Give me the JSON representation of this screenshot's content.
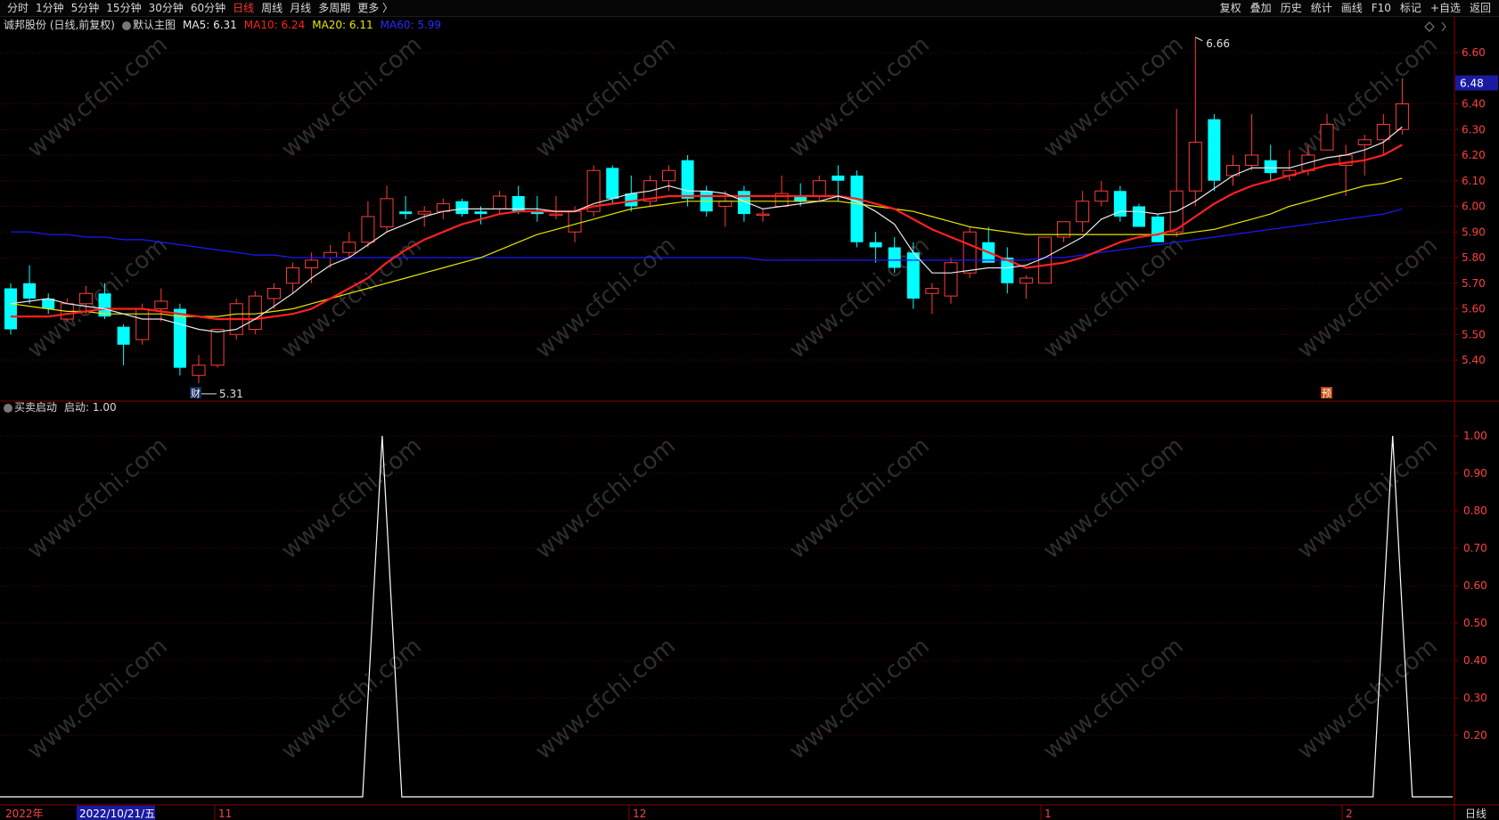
{
  "toolbar": {
    "periods": [
      "分时",
      "1分钟",
      "5分钟",
      "15分钟",
      "30分钟",
      "60分钟",
      "日线",
      "周线",
      "月线",
      "多周期",
      "更多 〉"
    ],
    "active_period": "日线",
    "right_items": [
      "复权",
      "叠加",
      "历史",
      "统计",
      "画线",
      "F10",
      "标记",
      "+自选",
      "返回"
    ]
  },
  "main_header": {
    "stock": "诚邦股份 (日线,前复权)",
    "template": "默认主图",
    "ma5": "MA5: 6.31",
    "ma10": "MA10: 6.24",
    "ma20": "MA20: 6.11",
    "ma60": "MA60: 5.99"
  },
  "colors": {
    "up": "#ff3b3b",
    "down": "#00ffff",
    "ma5": "#e8e8e8",
    "ma10": "#ff2020",
    "ma20": "#e6e600",
    "ma60": "#1a1aff",
    "grid": "#5a0000",
    "axis_text": "#ff4040",
    "indicator": "#ffffff"
  },
  "price_axis": {
    "labels": [
      "6.60",
      "6.40",
      "6.30",
      "6.20",
      "6.10",
      "6.00",
      "5.90",
      "5.80",
      "5.70",
      "5.60",
      "5.50",
      "5.40"
    ],
    "current_price": "6.48"
  },
  "annotations": {
    "high_label": "6.66",
    "low_label": "5.31",
    "finance_marker": "财",
    "forecast_marker": "预"
  },
  "indicator_header": {
    "name": "买卖启动",
    "value": "启动: 1.00"
  },
  "indicator_axis": {
    "labels": [
      "1.00",
      "0.90",
      "0.80",
      "0.70",
      "0.60",
      "0.50",
      "0.40",
      "0.30",
      "0.20"
    ]
  },
  "date_axis": {
    "year": "2022年",
    "cursor_date": "2022/10/21/五",
    "months": [
      "11",
      "12",
      "1",
      "2"
    ],
    "period_label": "日线"
  },
  "watermark": "www.cfchi.com",
  "chart_data": [
    {
      "type": "candlestick",
      "title": "诚邦股份 (日线,前复权)",
      "ylim": [
        5.31,
        6.72
      ],
      "candles": [
        {
          "o": 5.68,
          "h": 5.7,
          "l": 5.5,
          "c": 5.52
        },
        {
          "o": 5.7,
          "h": 5.77,
          "l": 5.62,
          "c": 5.64
        },
        {
          "o": 5.64,
          "h": 5.66,
          "l": 5.58,
          "c": 5.6
        },
        {
          "o": 5.56,
          "h": 5.64,
          "l": 5.55,
          "c": 5.62
        },
        {
          "o": 5.62,
          "h": 5.69,
          "l": 5.58,
          "c": 5.66
        },
        {
          "o": 5.66,
          "h": 5.7,
          "l": 5.56,
          "c": 5.57
        },
        {
          "o": 5.53,
          "h": 5.54,
          "l": 5.38,
          "c": 5.46
        },
        {
          "o": 5.48,
          "h": 5.62,
          "l": 5.46,
          "c": 5.6
        },
        {
          "o": 5.6,
          "h": 5.68,
          "l": 5.55,
          "c": 5.63
        },
        {
          "o": 5.6,
          "h": 5.62,
          "l": 5.34,
          "c": 5.37
        },
        {
          "o": 5.34,
          "h": 5.42,
          "l": 5.31,
          "c": 5.38
        },
        {
          "o": 5.38,
          "h": 5.48,
          "l": 5.37,
          "c": 5.52
        },
        {
          "o": 5.5,
          "h": 5.64,
          "l": 5.48,
          "c": 5.62
        },
        {
          "o": 5.52,
          "h": 5.67,
          "l": 5.5,
          "c": 5.65
        },
        {
          "o": 5.64,
          "h": 5.7,
          "l": 5.6,
          "c": 5.68
        },
        {
          "o": 5.7,
          "h": 5.78,
          "l": 5.66,
          "c": 5.76
        },
        {
          "o": 5.76,
          "h": 5.82,
          "l": 5.7,
          "c": 5.79
        },
        {
          "o": 5.8,
          "h": 5.85,
          "l": 5.76,
          "c": 5.82
        },
        {
          "o": 5.82,
          "h": 5.9,
          "l": 5.8,
          "c": 5.86
        },
        {
          "o": 5.86,
          "h": 6.02,
          "l": 5.84,
          "c": 5.96
        },
        {
          "o": 5.92,
          "h": 6.08,
          "l": 5.9,
          "c": 6.03
        },
        {
          "o": 5.98,
          "h": 6.04,
          "l": 5.95,
          "c": 5.97
        },
        {
          "o": 5.97,
          "h": 6.0,
          "l": 5.92,
          "c": 5.98
        },
        {
          "o": 5.98,
          "h": 6.03,
          "l": 5.95,
          "c": 6.01
        },
        {
          "o": 6.02,
          "h": 6.03,
          "l": 5.96,
          "c": 5.97
        },
        {
          "o": 5.98,
          "h": 6.0,
          "l": 5.93,
          "c": 5.97
        },
        {
          "o": 5.99,
          "h": 6.06,
          "l": 5.97,
          "c": 6.04
        },
        {
          "o": 6.04,
          "h": 6.08,
          "l": 5.97,
          "c": 5.98
        },
        {
          "o": 5.98,
          "h": 6.04,
          "l": 5.94,
          "c": 5.97
        },
        {
          "o": 5.97,
          "h": 6.04,
          "l": 5.95,
          "c": 5.97
        },
        {
          "o": 5.9,
          "h": 6.0,
          "l": 5.86,
          "c": 5.98
        },
        {
          "o": 5.98,
          "h": 6.16,
          "l": 5.96,
          "c": 6.14
        },
        {
          "o": 6.15,
          "h": 6.16,
          "l": 6.01,
          "c": 6.03
        },
        {
          "o": 6.05,
          "h": 6.12,
          "l": 5.98,
          "c": 6.0
        },
        {
          "o": 6.02,
          "h": 6.12,
          "l": 6.0,
          "c": 6.1
        },
        {
          "o": 6.1,
          "h": 6.16,
          "l": 6.06,
          "c": 6.14
        },
        {
          "o": 6.18,
          "h": 6.2,
          "l": 6.0,
          "c": 6.03
        },
        {
          "o": 6.06,
          "h": 6.08,
          "l": 5.96,
          "c": 5.98
        },
        {
          "o": 6.0,
          "h": 6.06,
          "l": 5.92,
          "c": 6.02
        },
        {
          "o": 6.06,
          "h": 6.08,
          "l": 5.94,
          "c": 5.97
        },
        {
          "o": 5.97,
          "h": 5.99,
          "l": 5.94,
          "c": 5.97
        },
        {
          "o": 6.0,
          "h": 6.12,
          "l": 6.0,
          "c": 6.05
        },
        {
          "o": 6.04,
          "h": 6.09,
          "l": 6.0,
          "c": 6.02
        },
        {
          "o": 6.04,
          "h": 6.12,
          "l": 6.02,
          "c": 6.1
        },
        {
          "o": 6.12,
          "h": 6.16,
          "l": 6.02,
          "c": 6.1
        },
        {
          "o": 6.12,
          "h": 6.14,
          "l": 5.84,
          "c": 5.86
        },
        {
          "o": 5.86,
          "h": 5.9,
          "l": 5.78,
          "c": 5.84
        },
        {
          "o": 5.84,
          "h": 5.88,
          "l": 5.74,
          "c": 5.76
        },
        {
          "o": 5.82,
          "h": 5.86,
          "l": 5.6,
          "c": 5.64
        },
        {
          "o": 5.66,
          "h": 5.7,
          "l": 5.58,
          "c": 5.68
        },
        {
          "o": 5.65,
          "h": 5.8,
          "l": 5.62,
          "c": 5.78
        },
        {
          "o": 5.74,
          "h": 5.92,
          "l": 5.72,
          "c": 5.9
        },
        {
          "o": 5.86,
          "h": 5.92,
          "l": 5.78,
          "c": 5.78
        },
        {
          "o": 5.8,
          "h": 5.84,
          "l": 5.66,
          "c": 5.7
        },
        {
          "o": 5.7,
          "h": 5.73,
          "l": 5.64,
          "c": 5.72
        },
        {
          "o": 5.7,
          "h": 5.88,
          "l": 5.7,
          "c": 5.88
        },
        {
          "o": 5.88,
          "h": 5.94,
          "l": 5.86,
          "c": 5.94
        },
        {
          "o": 5.94,
          "h": 6.06,
          "l": 5.9,
          "c": 6.02
        },
        {
          "o": 6.02,
          "h": 6.1,
          "l": 6.0,
          "c": 6.06
        },
        {
          "o": 6.06,
          "h": 6.08,
          "l": 5.94,
          "c": 5.96
        },
        {
          "o": 6.0,
          "h": 6.01,
          "l": 5.92,
          "c": 5.92
        },
        {
          "o": 5.96,
          "h": 5.97,
          "l": 5.86,
          "c": 5.86
        },
        {
          "o": 5.9,
          "h": 6.38,
          "l": 5.88,
          "c": 6.06
        },
        {
          "o": 6.06,
          "h": 6.66,
          "l": 6.0,
          "c": 6.25
        },
        {
          "o": 6.34,
          "h": 6.36,
          "l": 6.06,
          "c": 6.1
        },
        {
          "o": 6.12,
          "h": 6.2,
          "l": 6.08,
          "c": 6.16
        },
        {
          "o": 6.16,
          "h": 6.36,
          "l": 6.14,
          "c": 6.2
        },
        {
          "o": 6.18,
          "h": 6.24,
          "l": 6.1,
          "c": 6.13
        },
        {
          "o": 6.12,
          "h": 6.22,
          "l": 6.1,
          "c": 6.14
        },
        {
          "o": 6.14,
          "h": 6.24,
          "l": 6.12,
          "c": 6.2
        },
        {
          "o": 6.22,
          "h": 6.36,
          "l": 6.22,
          "c": 6.32
        },
        {
          "o": 6.16,
          "h": 6.24,
          "l": 6.04,
          "c": 6.2
        },
        {
          "o": 6.24,
          "h": 6.28,
          "l": 6.12,
          "c": 6.26
        },
        {
          "o": 6.26,
          "h": 6.36,
          "l": 6.2,
          "c": 6.32
        },
        {
          "o": 6.3,
          "h": 6.5,
          "l": 6.28,
          "c": 6.4
        }
      ],
      "ma5": [
        5.62,
        5.63,
        5.64,
        5.62,
        5.61,
        5.6,
        5.58,
        5.56,
        5.56,
        5.54,
        5.52,
        5.51,
        5.52,
        5.56,
        5.61,
        5.66,
        5.72,
        5.77,
        5.8,
        5.85,
        5.9,
        5.93,
        5.96,
        5.98,
        5.99,
        5.99,
        5.99,
        5.99,
        5.99,
        5.98,
        5.98,
        6.01,
        6.03,
        6.05,
        6.06,
        6.08,
        6.06,
        6.06,
        6.05,
        6.02,
        5.99,
        6.0,
        6.01,
        6.02,
        6.04,
        6.02,
        5.98,
        5.93,
        5.82,
        5.74,
        5.74,
        5.75,
        5.76,
        5.76,
        5.77,
        5.8,
        5.84,
        5.88,
        5.95,
        5.98,
        5.98,
        5.97,
        5.98,
        6.02,
        6.07,
        6.12,
        6.15,
        6.15,
        6.15,
        6.17,
        6.19,
        6.2,
        6.22,
        6.25,
        6.31
      ],
      "ma10": [
        5.57,
        5.57,
        5.57,
        5.58,
        5.59,
        5.6,
        5.6,
        5.6,
        5.59,
        5.58,
        5.57,
        5.56,
        5.56,
        5.56,
        5.57,
        5.58,
        5.6,
        5.64,
        5.68,
        5.72,
        5.78,
        5.83,
        5.87,
        5.9,
        5.93,
        5.95,
        5.97,
        5.98,
        5.98,
        5.98,
        5.98,
        6.0,
        6.01,
        6.02,
        6.03,
        6.04,
        6.04,
        6.04,
        6.04,
        6.04,
        6.04,
        6.04,
        6.04,
        6.04,
        6.04,
        6.03,
        6.01,
        5.99,
        5.95,
        5.91,
        5.88,
        5.85,
        5.82,
        5.79,
        5.76,
        5.77,
        5.78,
        5.8,
        5.83,
        5.86,
        5.88,
        5.89,
        5.91,
        5.96,
        6.01,
        6.05,
        6.08,
        6.1,
        6.12,
        6.14,
        6.16,
        6.17,
        6.18,
        6.2,
        6.24
      ],
      "ma20": [
        5.62,
        5.61,
        5.6,
        5.59,
        5.59,
        5.58,
        5.58,
        5.58,
        5.58,
        5.57,
        5.57,
        5.57,
        5.58,
        5.58,
        5.59,
        5.6,
        5.62,
        5.64,
        5.66,
        5.68,
        5.7,
        5.72,
        5.74,
        5.76,
        5.78,
        5.8,
        5.83,
        5.86,
        5.89,
        5.91,
        5.93,
        5.95,
        5.97,
        5.99,
        6.0,
        6.01,
        6.02,
        6.02,
        6.02,
        6.02,
        6.02,
        6.02,
        6.02,
        6.02,
        6.02,
        6.01,
        6.0,
        5.99,
        5.98,
        5.96,
        5.94,
        5.92,
        5.91,
        5.9,
        5.89,
        5.89,
        5.89,
        5.89,
        5.89,
        5.89,
        5.89,
        5.89,
        5.89,
        5.9,
        5.91,
        5.93,
        5.95,
        5.97,
        6.0,
        6.02,
        6.04,
        6.06,
        6.08,
        6.09,
        6.11
      ],
      "ma60": [
        5.9,
        5.9,
        5.89,
        5.89,
        5.88,
        5.88,
        5.87,
        5.87,
        5.86,
        5.85,
        5.84,
        5.83,
        5.82,
        5.81,
        5.81,
        5.8,
        5.8,
        5.8,
        5.8,
        5.8,
        5.8,
        5.8,
        5.8,
        5.8,
        5.8,
        5.8,
        5.8,
        5.8,
        5.8,
        5.8,
        5.8,
        5.8,
        5.8,
        5.8,
        5.8,
        5.8,
        5.8,
        5.8,
        5.8,
        5.8,
        5.79,
        5.79,
        5.79,
        5.79,
        5.79,
        5.79,
        5.79,
        5.79,
        5.79,
        5.79,
        5.79,
        5.79,
        5.79,
        5.79,
        5.79,
        5.8,
        5.8,
        5.81,
        5.82,
        5.83,
        5.84,
        5.85,
        5.86,
        5.87,
        5.88,
        5.89,
        5.9,
        5.91,
        5.92,
        5.93,
        5.94,
        5.95,
        5.96,
        5.97,
        5.99
      ]
    },
    {
      "type": "line",
      "title": "买卖启动",
      "ylim": [
        0,
        1
      ],
      "series": [
        {
          "name": "启动",
          "values": [
            0,
            0,
            0,
            0,
            0,
            0,
            0,
            0,
            0,
            0,
            0,
            0,
            0,
            0,
            0,
            0,
            0,
            0,
            0,
            1,
            0,
            0,
            0,
            0,
            0,
            0,
            0,
            0,
            0,
            0,
            0,
            0,
            0,
            0,
            0,
            0,
            0,
            0,
            0,
            0,
            0,
            0,
            0,
            0,
            0,
            0,
            0,
            0,
            0,
            0,
            0,
            0,
            0,
            0,
            0,
            0,
            0,
            0,
            0,
            0,
            0,
            0,
            0,
            0,
            0,
            0,
            0,
            0,
            0,
            0,
            0,
            0,
            0,
            1
          ]
        }
      ]
    }
  ]
}
